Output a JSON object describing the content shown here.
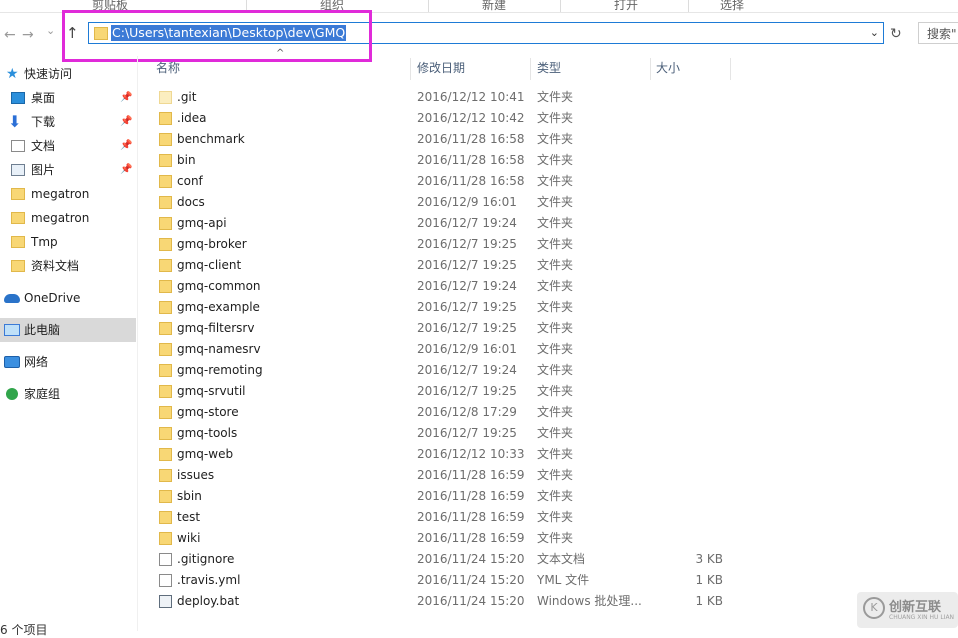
{
  "ribbon": {
    "clipboard": "剪贴板",
    "organize": "组织",
    "new": "新建",
    "open": "打开",
    "select": "选择"
  },
  "nav": {
    "back": "←",
    "forward": "→",
    "recent": "⌄",
    "up": "↑",
    "refresh": "↻",
    "dropdown": "⌄"
  },
  "address": {
    "path": "C:\\Users\\tantexian\\Desktop\\dev\\GMQ"
  },
  "search": {
    "placeholder": "搜索\""
  },
  "collapse": "^",
  "columns": {
    "name": "名称",
    "date": "修改日期",
    "type": "类型",
    "size": "大小"
  },
  "sidebar": {
    "items": [
      {
        "label": "快速访问",
        "icon": "star-icon"
      },
      {
        "label": "桌面",
        "icon": "desktop-icon",
        "pinned": true
      },
      {
        "label": "下载",
        "icon": "download-icon",
        "pinned": true
      },
      {
        "label": "文档",
        "icon": "document-icon",
        "pinned": true
      },
      {
        "label": "图片",
        "icon": "pictures-icon",
        "pinned": true
      },
      {
        "label": "megatron",
        "icon": "folder-icon"
      },
      {
        "label": "megatron",
        "icon": "folder-icon"
      },
      {
        "label": "Tmp",
        "icon": "folder-icon"
      },
      {
        "label": "资料文档",
        "icon": "folder-icon"
      },
      {
        "label": "OneDrive",
        "icon": "onedrive-icon"
      },
      {
        "label": "此电脑",
        "icon": "computer-icon",
        "selected": true
      },
      {
        "label": "网络",
        "icon": "network-icon"
      },
      {
        "label": "家庭组",
        "icon": "homegroup-icon"
      }
    ]
  },
  "files": [
    {
      "name": ".git",
      "date": "2016/12/12 10:41",
      "type": "文件夹",
      "size": "",
      "kind": "folder-hidden"
    },
    {
      "name": ".idea",
      "date": "2016/12/12 10:42",
      "type": "文件夹",
      "size": "",
      "kind": "folder"
    },
    {
      "name": "benchmark",
      "date": "2016/11/28 16:58",
      "type": "文件夹",
      "size": "",
      "kind": "folder"
    },
    {
      "name": "bin",
      "date": "2016/11/28 16:58",
      "type": "文件夹",
      "size": "",
      "kind": "folder"
    },
    {
      "name": "conf",
      "date": "2016/11/28 16:58",
      "type": "文件夹",
      "size": "",
      "kind": "folder"
    },
    {
      "name": "docs",
      "date": "2016/12/9 16:01",
      "type": "文件夹",
      "size": "",
      "kind": "folder"
    },
    {
      "name": "gmq-api",
      "date": "2016/12/7 19:24",
      "type": "文件夹",
      "size": "",
      "kind": "folder"
    },
    {
      "name": "gmq-broker",
      "date": "2016/12/7 19:25",
      "type": "文件夹",
      "size": "",
      "kind": "folder"
    },
    {
      "name": "gmq-client",
      "date": "2016/12/7 19:25",
      "type": "文件夹",
      "size": "",
      "kind": "folder"
    },
    {
      "name": "gmq-common",
      "date": "2016/12/7 19:24",
      "type": "文件夹",
      "size": "",
      "kind": "folder"
    },
    {
      "name": "gmq-example",
      "date": "2016/12/7 19:25",
      "type": "文件夹",
      "size": "",
      "kind": "folder"
    },
    {
      "name": "gmq-filtersrv",
      "date": "2016/12/7 19:25",
      "type": "文件夹",
      "size": "",
      "kind": "folder"
    },
    {
      "name": "gmq-namesrv",
      "date": "2016/12/9 16:01",
      "type": "文件夹",
      "size": "",
      "kind": "folder"
    },
    {
      "name": "gmq-remoting",
      "date": "2016/12/7 19:24",
      "type": "文件夹",
      "size": "",
      "kind": "folder"
    },
    {
      "name": "gmq-srvutil",
      "date": "2016/12/7 19:25",
      "type": "文件夹",
      "size": "",
      "kind": "folder"
    },
    {
      "name": "gmq-store",
      "date": "2016/12/8 17:29",
      "type": "文件夹",
      "size": "",
      "kind": "folder"
    },
    {
      "name": "gmq-tools",
      "date": "2016/12/7 19:25",
      "type": "文件夹",
      "size": "",
      "kind": "folder"
    },
    {
      "name": "gmq-web",
      "date": "2016/12/12 10:33",
      "type": "文件夹",
      "size": "",
      "kind": "folder"
    },
    {
      "name": "issues",
      "date": "2016/11/28 16:59",
      "type": "文件夹",
      "size": "",
      "kind": "folder"
    },
    {
      "name": "sbin",
      "date": "2016/11/28 16:59",
      "type": "文件夹",
      "size": "",
      "kind": "folder"
    },
    {
      "name": "test",
      "date": "2016/11/28 16:59",
      "type": "文件夹",
      "size": "",
      "kind": "folder"
    },
    {
      "name": "wiki",
      "date": "2016/11/28 16:59",
      "type": "文件夹",
      "size": "",
      "kind": "folder"
    },
    {
      "name": ".gitignore",
      "date": "2016/11/24 15:20",
      "type": "文本文档",
      "size": "3 KB",
      "kind": "file"
    },
    {
      "name": ".travis.yml",
      "date": "2016/11/24 15:20",
      "type": "YML 文件",
      "size": "1 KB",
      "kind": "file"
    },
    {
      "name": "deploy.bat",
      "date": "2016/11/24 15:20",
      "type": "Windows 批处理...",
      "size": "1 KB",
      "kind": "bat"
    }
  ],
  "status": {
    "count": "6 个项目"
  },
  "watermark": {
    "brand": "创新互联",
    "sub": "CHUANG XIN HU LIAN",
    "mark": "K"
  }
}
